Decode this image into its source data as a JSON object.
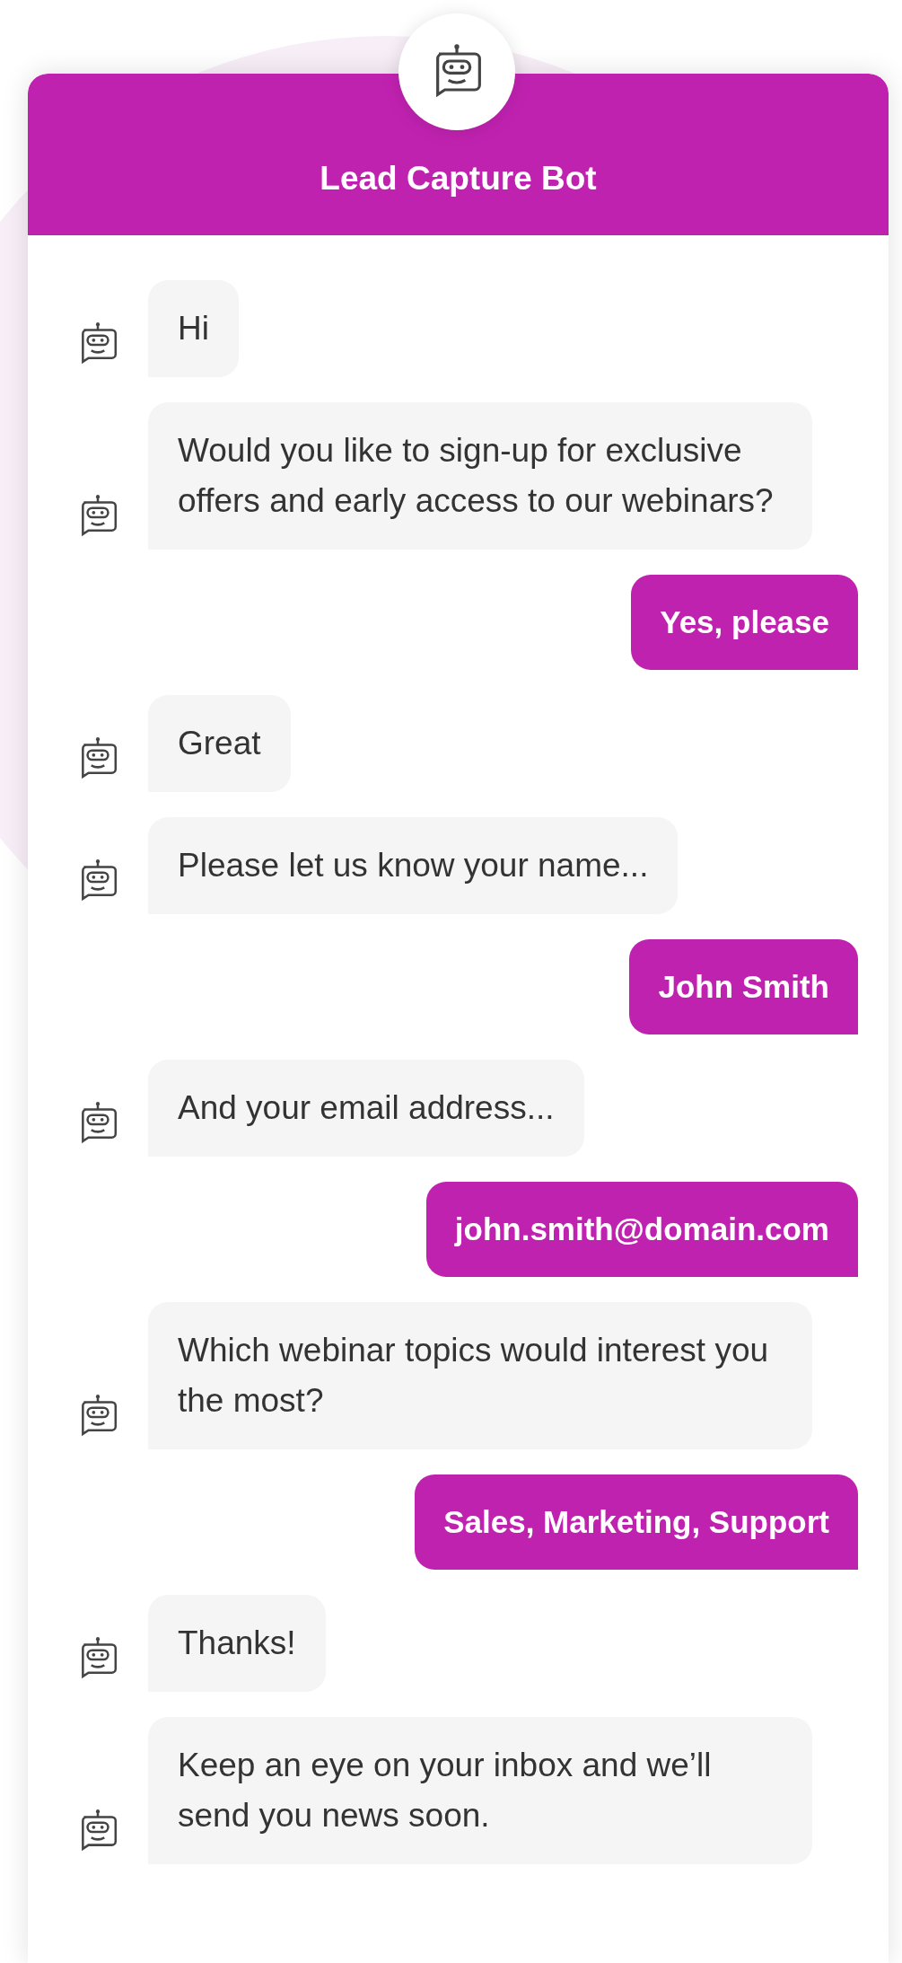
{
  "header": {
    "title": "Lead Capture Bot"
  },
  "messages": [
    {
      "kind": "bot",
      "text": "Hi"
    },
    {
      "kind": "bot",
      "text": "Would you like to sign-up for exclusive offers and early access to our webinars?"
    },
    {
      "kind": "user",
      "text": "Yes, please"
    },
    {
      "kind": "bot",
      "text": "Great"
    },
    {
      "kind": "bot",
      "text": "Please let us know your name..."
    },
    {
      "kind": "user",
      "text": "John Smith"
    },
    {
      "kind": "bot",
      "text": "And your email address..."
    },
    {
      "kind": "user",
      "text": "john.smith@domain.com"
    },
    {
      "kind": "bot",
      "text": "Which webinar topics would interest you the most?"
    },
    {
      "kind": "user",
      "text": "Sales, Marketing, Support"
    },
    {
      "kind": "bot",
      "text": "Thanks!"
    },
    {
      "kind": "bot",
      "text": "Keep an eye on your inbox and we’ll send you news soon."
    }
  ]
}
